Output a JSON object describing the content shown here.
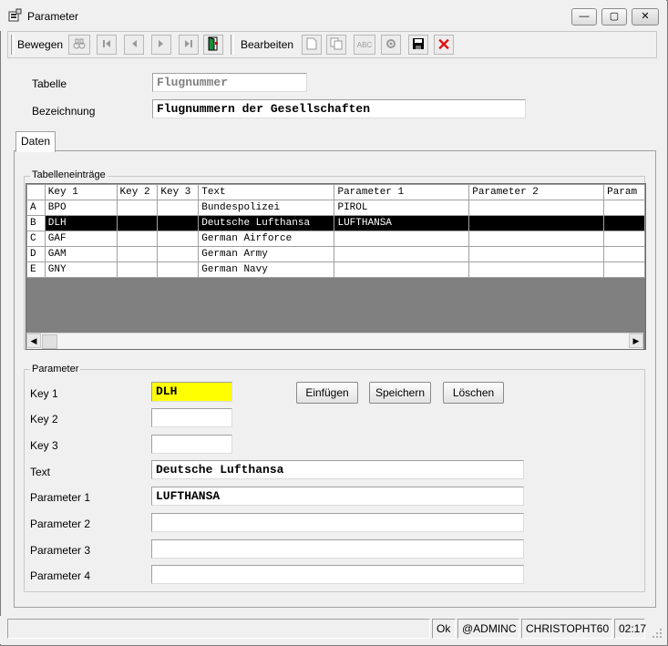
{
  "window": {
    "title": "Parameter",
    "controls": {
      "minimize": "—",
      "maximize": "▢",
      "close": "✕"
    }
  },
  "toolbar": {
    "group1_label": "Bewegen",
    "group2_label": "Bearbeiten",
    "icons": [
      "binoculars-icon",
      "first-record-icon",
      "prev-record-icon",
      "next-record-icon",
      "last-record-icon",
      "exit-door-icon",
      "new-doc-icon",
      "copy-icon",
      "spellcheck-icon",
      "settings-icon",
      "save-icon",
      "delete-icon"
    ],
    "spellcheck_text": "ABC",
    "delete_glyph": "✕",
    "colors": {
      "delete": "#e01010",
      "exit": "#1a8a3a"
    }
  },
  "header": {
    "tabelle_label": "Tabelle",
    "tabelle_value": "Flugnummer",
    "bezeichnung_label": "Bezeichnung",
    "bezeichnung_value": "Flugnummern der Gesellschaften"
  },
  "tabs": [
    {
      "label": "Daten"
    }
  ],
  "table": {
    "group_title": "Tabelleneinträge",
    "columns": [
      "Key 1",
      "Key 2",
      "Key 3",
      "Text",
      "Parameter 1",
      "Parameter 2",
      "Param"
    ],
    "rows": [
      {
        "rowhead": "A",
        "key1": "BPO",
        "key2": "",
        "key3": "",
        "text": "Bundespolizei",
        "p1": "PIROL",
        "p2": "",
        "p3": ""
      },
      {
        "rowhead": "B",
        "key1": "DLH",
        "key2": "",
        "key3": "",
        "text": "Deutsche Lufthansa",
        "p1": "LUFTHANSA",
        "p2": "",
        "p3": "",
        "selected": true
      },
      {
        "rowhead": "C",
        "key1": "GAF",
        "key2": "",
        "key3": "",
        "text": "German Airforce",
        "p1": "",
        "p2": "",
        "p3": ""
      },
      {
        "rowhead": "D",
        "key1": "GAM",
        "key2": "",
        "key3": "",
        "text": "German Army",
        "p1": "",
        "p2": "",
        "p3": ""
      },
      {
        "rowhead": "E",
        "key1": "GNY",
        "key2": "",
        "key3": "",
        "text": "German Navy",
        "p1": "",
        "p2": "",
        "p3": ""
      }
    ],
    "scroll_left": "◀",
    "scroll_right": "▶"
  },
  "form": {
    "group_title": "Parameter",
    "key1_label": "Key 1",
    "key1_value": "DLH",
    "key2_label": "Key 2",
    "key2_value": "",
    "key3_label": "Key 3",
    "key3_value": "",
    "text_label": "Text",
    "text_value": "Deutsche Lufthansa",
    "p1_label": "Parameter 1",
    "p1_value": "LUFTHANSA",
    "p2_label": "Parameter 2",
    "p2_value": "",
    "p3_label": "Parameter 3",
    "p3_value": "",
    "p4_label": "Parameter 4",
    "p4_value": "",
    "buttons": {
      "insert": "Einfügen",
      "save": "Speichern",
      "delete": "Löschen"
    },
    "key1_highlight": "#ffff00"
  },
  "statusbar": {
    "status": "Ok",
    "schema": "@ADMINC",
    "user": "CHRISTOPHT60",
    "time": "02:17"
  }
}
